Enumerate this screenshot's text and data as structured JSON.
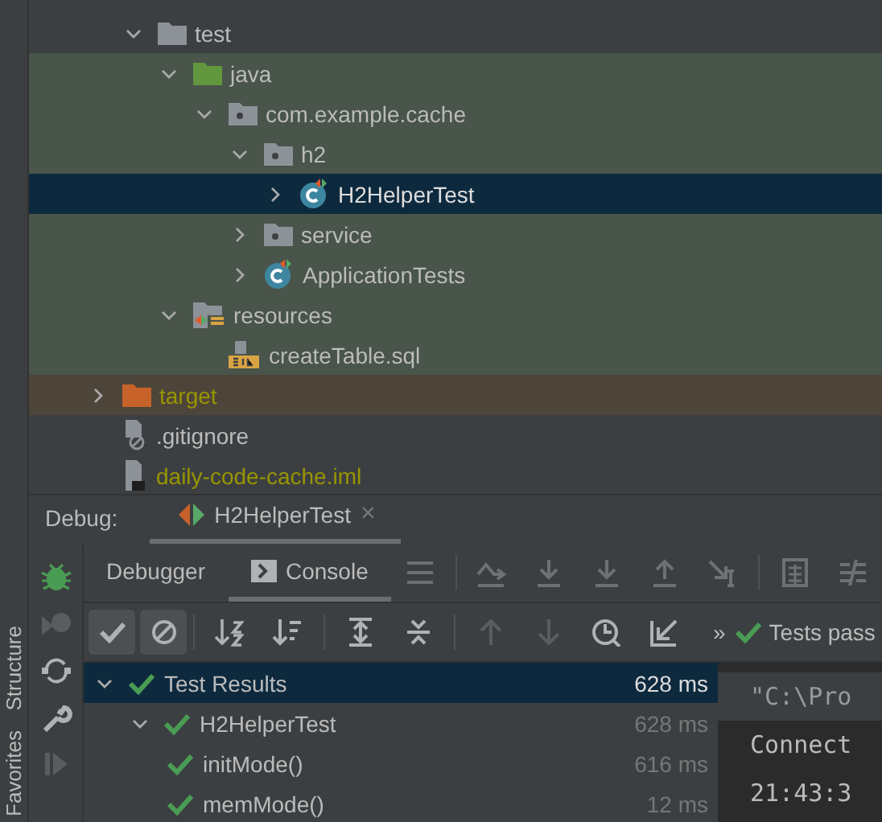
{
  "side_strip": {
    "labels": [
      "Structure",
      "Favorites"
    ]
  },
  "project_tree": {
    "scrolled_items": [
      {
        "name": "test",
        "kind": "folder",
        "test_scope": false,
        "excluded": false,
        "expanded": true,
        "selected": false,
        "children": [
          {
            "name": "java",
            "kind": "test-source-folder",
            "test_scope": true,
            "excluded": false,
            "expanded": true,
            "selected": false,
            "children": [
              {
                "name": "com.example.cache",
                "kind": "package",
                "test_scope": true,
                "excluded": false,
                "expanded": true,
                "selected": false,
                "children": [
                  {
                    "name": "h2",
                    "kind": "package",
                    "test_scope": true,
                    "excluded": false,
                    "expanded": true,
                    "selected": false,
                    "children": [
                      {
                        "name": "H2HelperTest",
                        "kind": "test-class",
                        "expanded": false,
                        "selected": true
                      }
                    ]
                  },
                  {
                    "name": "service",
                    "kind": "package",
                    "test_scope": true,
                    "excluded": false,
                    "expanded": false,
                    "selected": false
                  },
                  {
                    "name": "ApplicationTests",
                    "kind": "test-class",
                    "test_scope": true,
                    "excluded": false,
                    "expanded": false,
                    "selected": false
                  }
                ]
              }
            ]
          },
          {
            "name": "resources",
            "kind": "test-resource-folder",
            "test_scope": true,
            "excluded": false,
            "expanded": true,
            "selected": false,
            "children": [
              {
                "name": "createTable.sql",
                "kind": "sql-file",
                "test_scope": true,
                "excluded": false,
                "selected": false
              }
            ]
          }
        ]
      }
    ],
    "items": [
      {
        "name": "target",
        "kind": "excluded-folder",
        "test_scope": false,
        "excluded": true,
        "expanded": false,
        "selected": false
      },
      {
        "name": ".gitignore",
        "kind": "ignore-file",
        "test_scope": false,
        "excluded": false,
        "selected": false
      },
      {
        "name": "daily-code-cache.iml",
        "kind": "module-file",
        "test_scope": false,
        "excluded": true,
        "selected": false
      }
    ]
  },
  "debug": {
    "label": "Debug:",
    "session_tab": {
      "title": "H2HelperTest",
      "close": "×"
    },
    "tabs": [
      {
        "label": "Debugger",
        "selected": false
      },
      {
        "label": "Console",
        "selected": true
      }
    ],
    "filter_toggles": [
      {
        "kind": "show-passed",
        "on": true
      },
      {
        "kind": "show-ignored",
        "on": true
      }
    ],
    "more": "»",
    "status": "Tests pass",
    "results": [
      {
        "name": "Test Results",
        "time": "628 ms",
        "passed": true,
        "selected": true,
        "expanded": true,
        "children": [
          {
            "name": "H2HelperTest",
            "time": "628 ms",
            "passed": true,
            "selected": false,
            "expanded": true,
            "children": [
              {
                "name": "initMode()",
                "time": "616 ms",
                "passed": true,
                "selected": false
              },
              {
                "name": "memMode()",
                "time": "12 ms",
                "passed": true,
                "selected": false
              }
            ]
          }
        ]
      }
    ],
    "console_lines": [
      "\"C:\\Pro",
      "Connect",
      "21:43:3"
    ]
  }
}
